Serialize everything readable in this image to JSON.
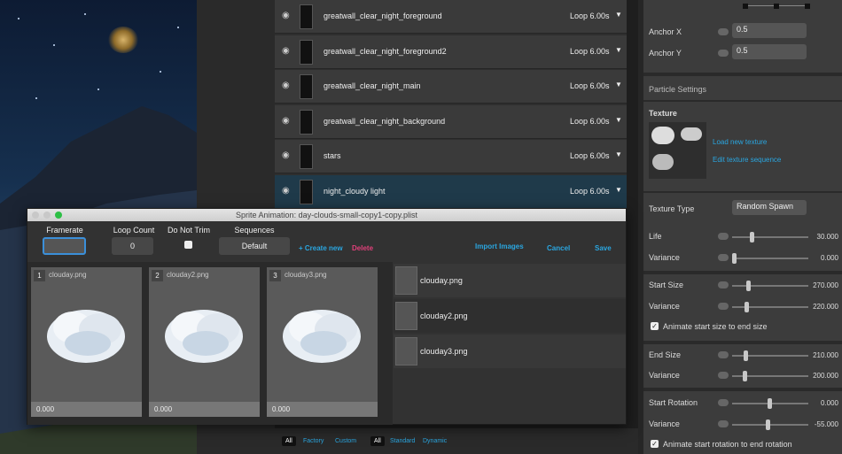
{
  "layers": [
    {
      "name": "greatwall_clear_night_foreground",
      "loop": "Loop 6.00s"
    },
    {
      "name": "greatwall_clear_night_foreground2",
      "loop": "Loop 6.00s"
    },
    {
      "name": "greatwall_clear_night_main",
      "loop": "Loop 6.00s"
    },
    {
      "name": "greatwall_clear_night_background",
      "loop": "Loop 6.00s"
    },
    {
      "name": "stars",
      "loop": "Loop 6.00s"
    },
    {
      "name": "night_cloudy light",
      "loop": "Loop 6.00s"
    }
  ],
  "right": {
    "anchor_x_label": "Anchor X",
    "anchor_x": "0.5",
    "anchor_y_label": "Anchor Y",
    "anchor_y": "0.5",
    "particle_settings": "Particle Settings",
    "texture": "Texture",
    "load_texture": "Load new texture",
    "edit_sequence": "Edit texture sequence",
    "texture_type_label": "Texture Type",
    "texture_type": "Random Spawn",
    "life_label": "Life",
    "life": "30.000",
    "life_frac": 0.25,
    "variance1_label": "Variance",
    "variance1": "0.000",
    "variance1_frac": 0.0,
    "start_size_label": "Start Size",
    "start_size": "270.000",
    "start_size_frac": 0.2,
    "variance2_label": "Variance",
    "variance2": "220.000",
    "variance2_frac": 0.17,
    "animate_size": "Animate start size to end size",
    "end_size_label": "End Size",
    "end_size": "210.000",
    "end_size_frac": 0.16,
    "variance3_label": "Variance",
    "variance3": "200.000",
    "variance3_frac": 0.15,
    "start_rotation_label": "Start Rotation",
    "start_rotation": "0.000",
    "start_rotation_frac": 0.5,
    "variance4_label": "Variance",
    "variance4": "-55.000",
    "variance4_frac": 0.48,
    "animate_rotation": "Animate start rotation to end rotation"
  },
  "bottom": {
    "all1": "All",
    "factory": "Factory",
    "custom": "Custom",
    "all2": "All",
    "standard": "Standard",
    "dynamic": "Dynamic"
  },
  "dialog": {
    "title": "Sprite Animation: day-clouds-small-copy1-copy.plist",
    "framerate_label": "Framerate",
    "framerate": "",
    "loop_count_label": "Loop Count",
    "loop_count": "0",
    "do_not_trim_label": "Do Not Trim",
    "sequences_label": "Sequences",
    "sequence": "Default",
    "create_new": "+ Create new",
    "delete": "Delete",
    "import_images": "Import Images",
    "cancel": "Cancel",
    "save": "Save",
    "frames": [
      {
        "num": "1",
        "name": "clouday.png",
        "value": "0.000"
      },
      {
        "num": "2",
        "name": "clouday2.png",
        "value": "0.000"
      },
      {
        "num": "3",
        "name": "clouday3.png",
        "value": "0.000"
      }
    ],
    "sprites": [
      {
        "name": "clouday.png"
      },
      {
        "name": "clouday2.png"
      },
      {
        "name": "clouday3.png"
      }
    ]
  },
  "colors": {
    "accent": "#2aa6e0",
    "delete": "#e0407a",
    "selected_row": "#1f3a4a"
  }
}
